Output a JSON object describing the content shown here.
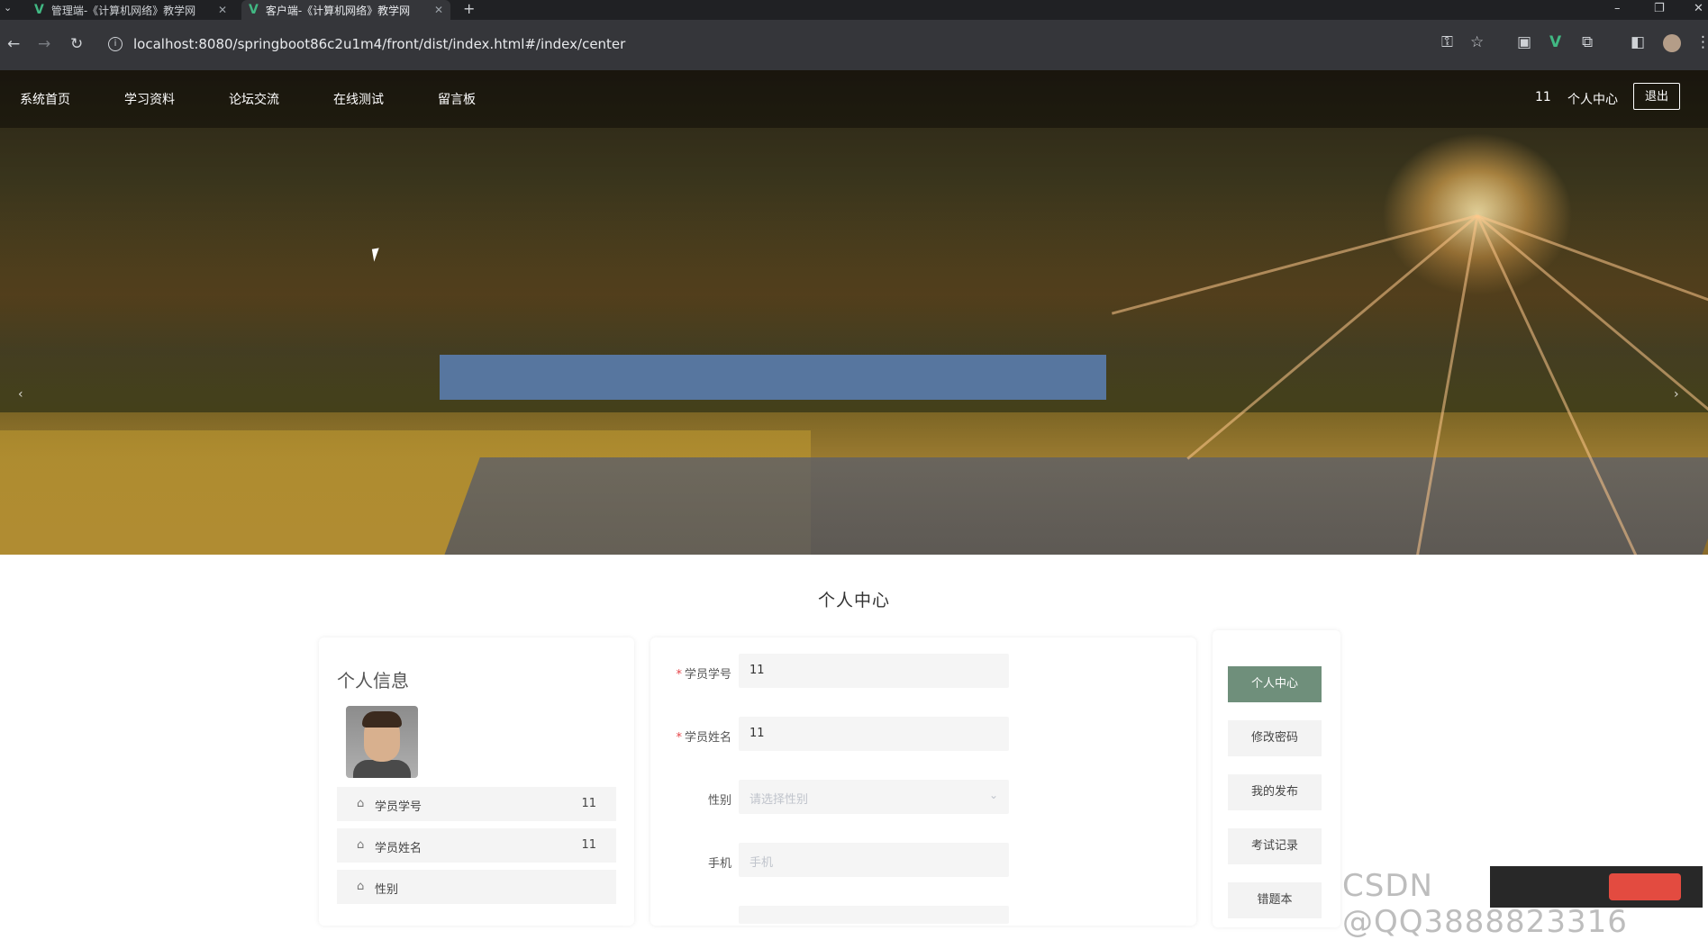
{
  "browser": {
    "tabs": [
      {
        "title": "管理端-《计算机网络》教学网",
        "active": false
      },
      {
        "title": "客户端-《计算机网络》教学网",
        "active": true
      }
    ],
    "new_tab": "+",
    "url": "localhost:8080/springboot86c2u1m4/front/dist/index.html#/index/center"
  },
  "nav": {
    "items": [
      "系统首页",
      "学习资料",
      "论坛交流",
      "在线测试",
      "留言板"
    ],
    "username": "11",
    "center_link": "个人中心",
    "logout": "退出"
  },
  "banner": {
    "slide_count": 3,
    "active_slide": 3
  },
  "page_title": "个人中心",
  "profile": {
    "title": "个人信息",
    "rows": [
      {
        "label": "学员学号",
        "value": "11"
      },
      {
        "label": "学员姓名",
        "value": "11"
      },
      {
        "label": "性别",
        "value": ""
      }
    ]
  },
  "form": {
    "fields": [
      {
        "label": "学员学号",
        "required": true,
        "value": "11",
        "placeholder": ""
      },
      {
        "label": "学员姓名",
        "required": true,
        "value": "11",
        "placeholder": ""
      },
      {
        "label": "性别",
        "required": false,
        "value": "",
        "placeholder": "请选择性别"
      },
      {
        "label": "手机",
        "required": false,
        "value": "",
        "placeholder": "手机"
      }
    ]
  },
  "side_menu": [
    "个人中心",
    "修改密码",
    "我的发布",
    "考试记录",
    "错题本"
  ],
  "watermark": "CSDN @QQ3888823316",
  "colors": {
    "accent": "#6f8f7b",
    "required": "#e5464a",
    "vue_green": "#41b883"
  }
}
